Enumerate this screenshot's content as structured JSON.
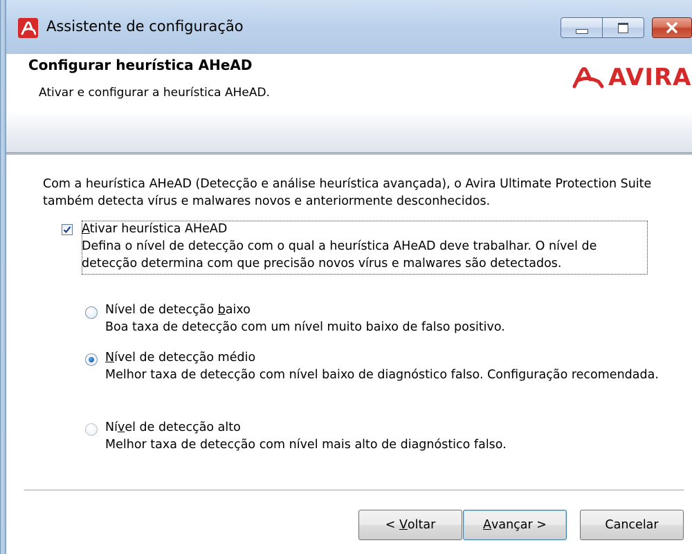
{
  "window": {
    "title": "Assistente de configuração",
    "controls": [
      "minimize",
      "maximize",
      "close"
    ]
  },
  "header": {
    "title": "Configurar heurística AHeAD",
    "subtitle": "Ativar e configurar a heurística AHeAD.",
    "brand": "AVIRA",
    "brand_color": "#d52a29"
  },
  "intro": "Com a heurística AHeAD (Detecção e análise heurística avançada), o Avira Ultimate Protection Suite também detecta vírus e malwares novos e anteriormente desconhecidos.",
  "ahead_checkbox": {
    "label_prefix": "A",
    "label_rest": "tivar heurística AHeAD",
    "checked": true,
    "description": "Defina o nível de detecção com o qual a heurística AHeAD deve trabalhar. O nível de detecção determina com que precisão novos vírus e malwares são detectados."
  },
  "levels": [
    {
      "label_before": "Nível de detecção ",
      "label_underlined": "b",
      "label_after": "aixo",
      "description": "Boa taxa de detecção com um nível muito baixo de falso positivo.",
      "selected": false,
      "enabled": true
    },
    {
      "label_before": "",
      "label_underlined": "N",
      "label_after": "ível de detecção médio",
      "description": "Melhor taxa de detecção com nível baixo de diagnóstico falso. Configuração recomendada.",
      "selected": true,
      "enabled": true
    },
    {
      "label_before": "Ní",
      "label_underlined": "v",
      "label_after": "el de detecção alto",
      "description": "Melhor taxa de detecção com nível mais alto de diagnóstico falso.",
      "selected": false,
      "enabled": false
    }
  ],
  "buttons": {
    "back_prefix": "< ",
    "back_underlined": "V",
    "back_rest": "oltar",
    "next_underlined": "A",
    "next_rest": "vançar >",
    "cancel": "Cancelar"
  }
}
